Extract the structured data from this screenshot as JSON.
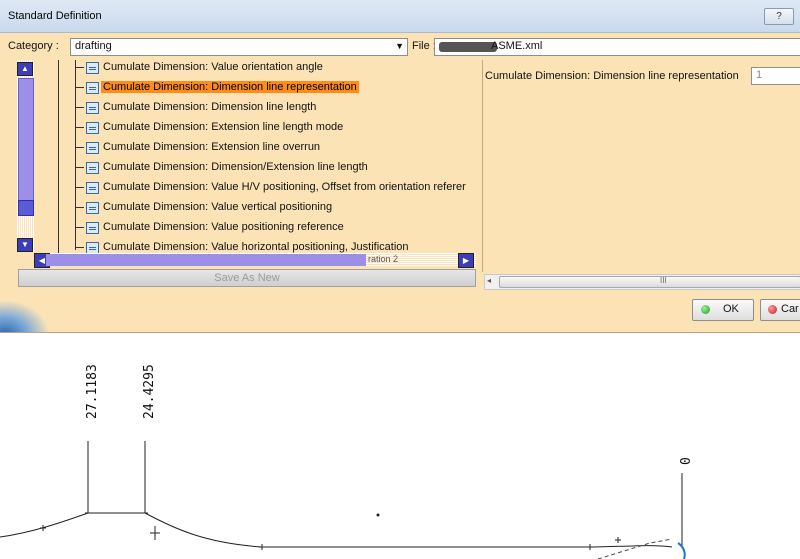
{
  "dialog": {
    "title": "Standard Definition",
    "help_label": "?",
    "category_label": "Category :",
    "category_value": "drafting",
    "file_label": "File :",
    "file_value": "ASME.xml",
    "tree_items": [
      {
        "label": "Cumulate Dimension: Value orientation angle",
        "selected": false
      },
      {
        "label": "Cumulate Dimension: Dimension line representation",
        "selected": true
      },
      {
        "label": "Cumulate Dimension: Dimension line length",
        "selected": false
      },
      {
        "label": "Cumulate Dimension: Extension line length mode",
        "selected": false
      },
      {
        "label": "Cumulate Dimension: Extension line overrun",
        "selected": false
      },
      {
        "label": "Cumulate Dimension: Dimension/Extension line length",
        "selected": false
      },
      {
        "label": "Cumulate Dimension: Value H/V positioning, Offset from orientation referer",
        "selected": false
      },
      {
        "label": "Cumulate Dimension: Value vertical positioning",
        "selected": false
      },
      {
        "label": "Cumulate Dimension: Value positioning reference",
        "selected": false
      },
      {
        "label": "Cumulate Dimension: Value horizontal positioning, Justification",
        "selected": false
      }
    ],
    "hscroll_partial_text": "ration 2",
    "save_as_new_label": "Save As New",
    "property_label": "Cumulate Dimension: Dimension line representation",
    "property_value": "1",
    "ok_label": "OK",
    "cancel_label": "Car",
    "right_scroll_grip": "III"
  },
  "drawing": {
    "dimension_1": "27.1183",
    "dimension_2": "24.4295",
    "point_label": "0"
  }
}
